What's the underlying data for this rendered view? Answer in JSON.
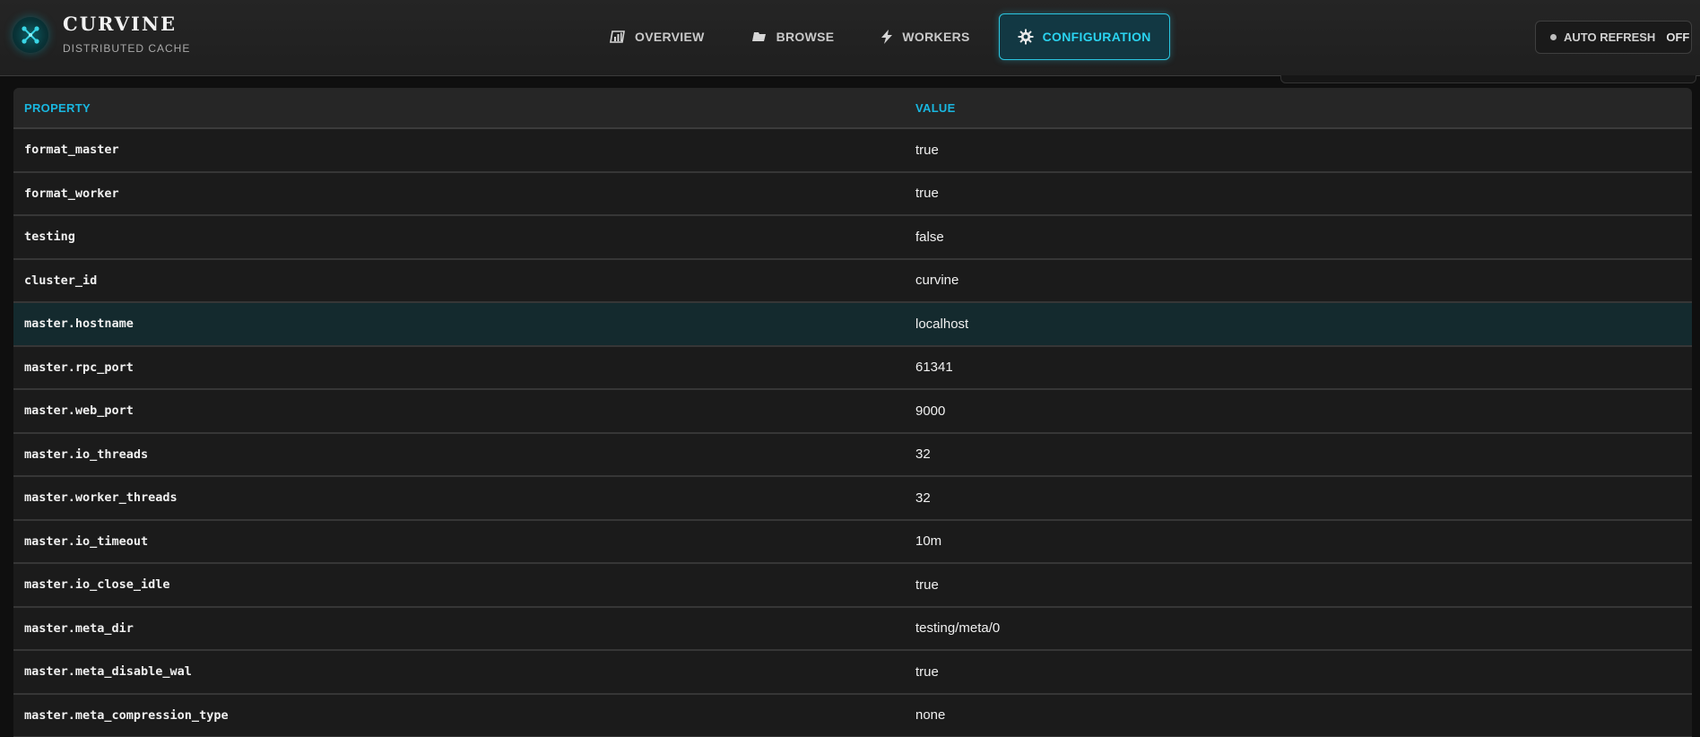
{
  "brand": {
    "name": "CURVINE",
    "subtitle": "DISTRIBUTED CACHE",
    "logo_icon": "network-node-icon"
  },
  "nav": {
    "items": [
      {
        "label": "OVERVIEW",
        "icon": "chart-bars-icon",
        "active": false
      },
      {
        "label": "BROWSE",
        "icon": "folder-icon",
        "active": false
      },
      {
        "label": "WORKERS",
        "icon": "lightning-icon",
        "active": false
      },
      {
        "label": "CONFIGURATION",
        "icon": "gear-icon",
        "active": true
      }
    ]
  },
  "auto_refresh": {
    "label": "AUTO REFRESH",
    "state": "OFF"
  },
  "table": {
    "headers": [
      "PROPERTY",
      "VALUE"
    ],
    "rows": [
      {
        "key": "format_master",
        "value": "true"
      },
      {
        "key": "format_worker",
        "value": "true"
      },
      {
        "key": "testing",
        "value": "false"
      },
      {
        "key": "cluster_id",
        "value": "curvine"
      },
      {
        "key": "master.hostname",
        "value": "localhost"
      },
      {
        "key": "master.rpc_port",
        "value": "61341"
      },
      {
        "key": "master.web_port",
        "value": "9000"
      },
      {
        "key": "master.io_threads",
        "value": "32"
      },
      {
        "key": "master.worker_threads",
        "value": "32"
      },
      {
        "key": "master.io_timeout",
        "value": "10m"
      },
      {
        "key": "master.io_close_idle",
        "value": "true"
      },
      {
        "key": "master.meta_dir",
        "value": "testing/meta/0"
      },
      {
        "key": "master.meta_disable_wal",
        "value": "true"
      },
      {
        "key": "master.meta_compression_type",
        "value": "none"
      }
    ]
  },
  "colors": {
    "accent": "#2ad3f0",
    "header_text": "#19b7e0",
    "highlight_row": "#142a2e"
  }
}
